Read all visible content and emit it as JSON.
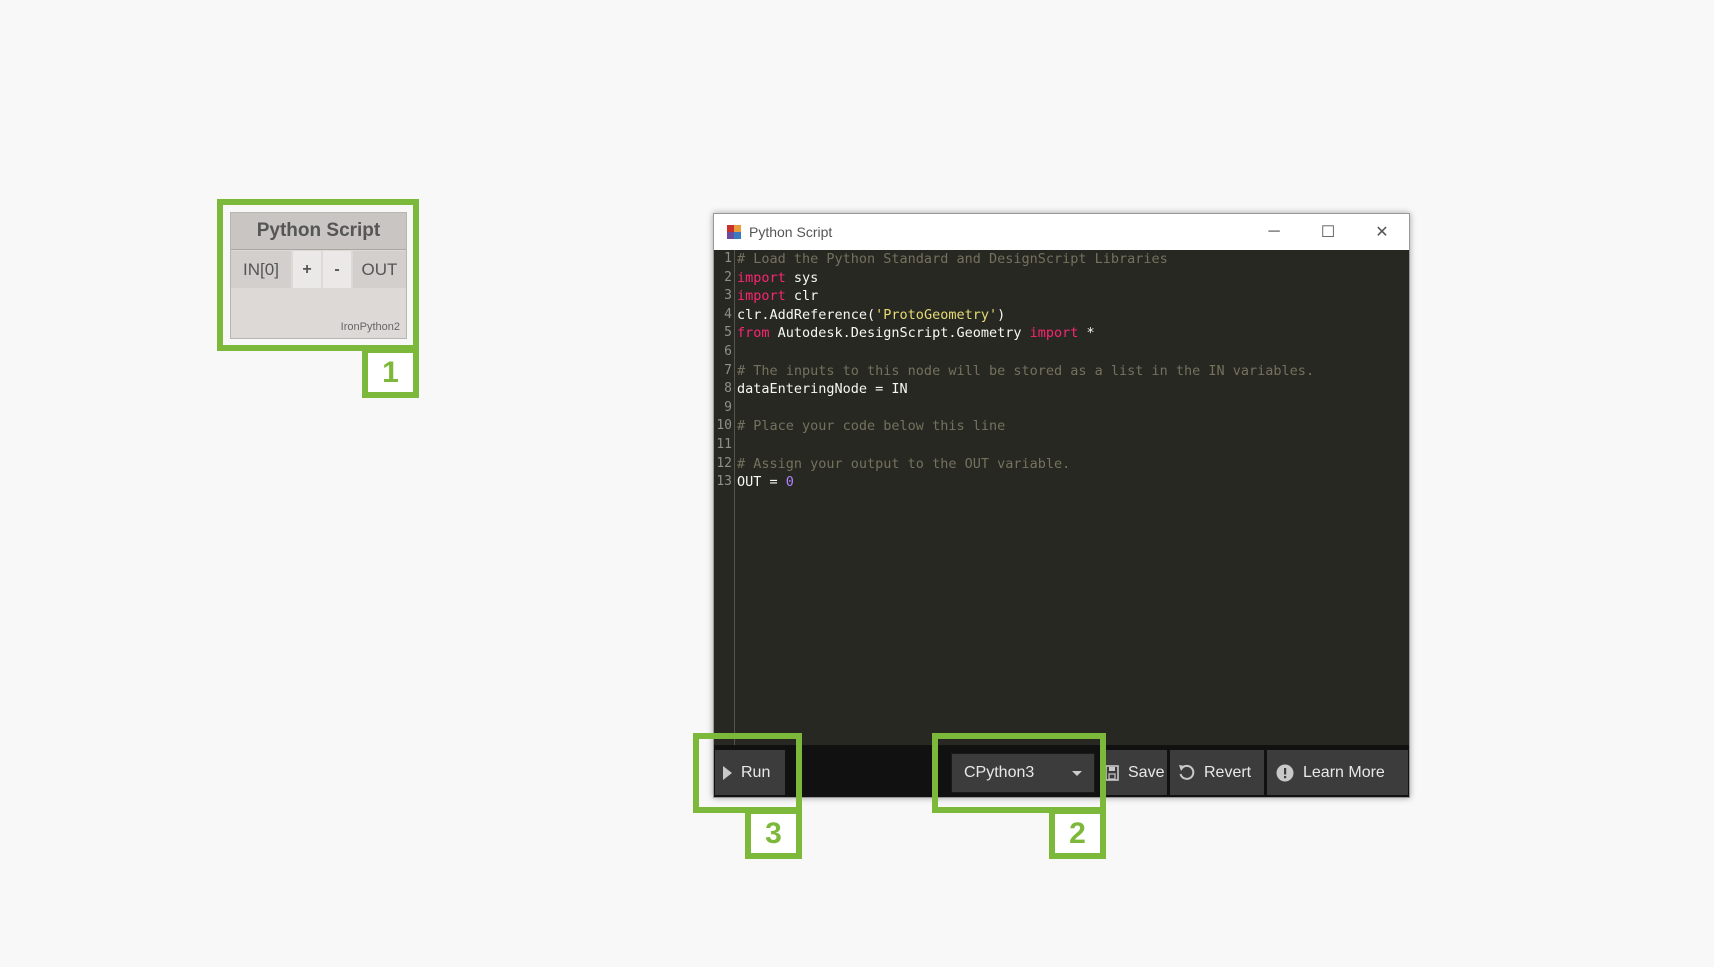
{
  "node": {
    "title": "Python Script",
    "input_port": "IN[0]",
    "add_input": "+",
    "remove_input": "-",
    "output_port": "OUT",
    "engine": "IronPython2"
  },
  "callouts": {
    "one": "1",
    "two": "2",
    "three": "3"
  },
  "window": {
    "title": "Python Script",
    "minimize": "─",
    "maximize": "☐",
    "close": "✕"
  },
  "code": {
    "line_numbers": [
      "1",
      "2",
      "3",
      "4",
      "5",
      "6",
      "7",
      "8",
      "9",
      "10",
      "11",
      "12",
      "13"
    ],
    "l1": "# Load the Python Standard and DesignScript Libraries",
    "l2_kw": "import",
    "l2_rest": " sys",
    "l3_kw": "import",
    "l3_rest": " clr",
    "l4_a": "clr.AddReference(",
    "l4_str": "'ProtoGeometry'",
    "l4_b": ")",
    "l5_kw1": "from",
    "l5_mid": " Autodesk.DesignScript.Geometry ",
    "l5_kw2": "import",
    "l5_end": " *",
    "l7": "# The inputs to this node will be stored as a list in the IN variables.",
    "l8": "dataEnteringNode = IN",
    "l10": "# Place your code below this line",
    "l12": "# Assign your output to the OUT variable.",
    "l13_a": "OUT = ",
    "l13_num": "0"
  },
  "toolbar": {
    "run_label": "Run",
    "engine_selected": "CPython3",
    "save_label": "Save",
    "revert_label": "Revert",
    "learn_more_label": "Learn More"
  },
  "icons": [
    "run-icon",
    "dropdown-arrow-icon",
    "save-icon",
    "revert-icon",
    "info-icon",
    "app-icon"
  ],
  "colors": {
    "callout": "#7cb83a",
    "editor_bg": "#272822",
    "keyword": "#f92672",
    "string": "#e6db74",
    "comment": "#75715e",
    "number": "#ae81ff"
  }
}
